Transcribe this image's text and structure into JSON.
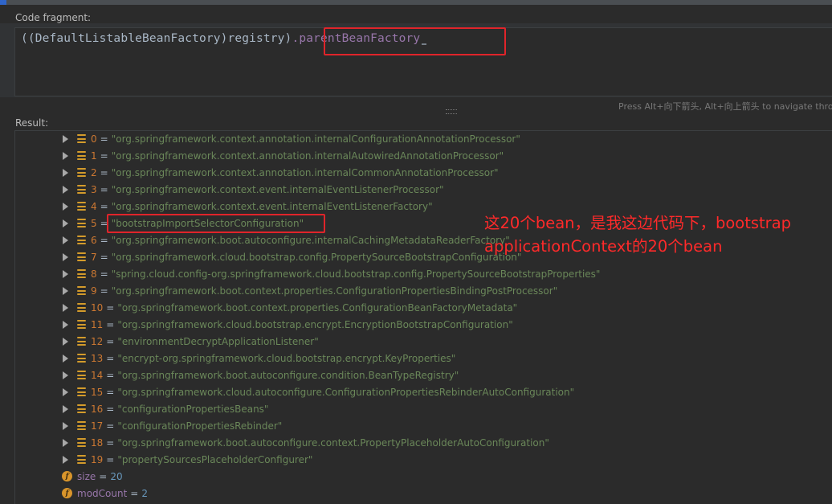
{
  "code_fragment_label": "Code fragment:",
  "code": {
    "prefix": "((DefaultListableBeanFactory)registry)",
    "field": ".parentBeanFactory"
  },
  "hint": "Press Alt+向下箭头, Alt+向上箭头 to navigate throu",
  "result_label": "Result:",
  "items": [
    {
      "index": "0",
      "value": "\"org.springframework.context.annotation.internalConfigurationAnnotationProcessor\""
    },
    {
      "index": "1",
      "value": "\"org.springframework.context.annotation.internalAutowiredAnnotationProcessor\""
    },
    {
      "index": "2",
      "value": "\"org.springframework.context.annotation.internalCommonAnnotationProcessor\""
    },
    {
      "index": "3",
      "value": "\"org.springframework.context.event.internalEventListenerProcessor\""
    },
    {
      "index": "4",
      "value": "\"org.springframework.context.event.internalEventListenerFactory\""
    },
    {
      "index": "5",
      "value": "\"bootstrapImportSelectorConfiguration\""
    },
    {
      "index": "6",
      "value": "\"org.springframework.boot.autoconfigure.internalCachingMetadataReaderFactory\""
    },
    {
      "index": "7",
      "value": "\"org.springframework.cloud.bootstrap.config.PropertySourceBootstrapConfiguration\""
    },
    {
      "index": "8",
      "value": "\"spring.cloud.config-org.springframework.cloud.bootstrap.config.PropertySourceBootstrapProperties\""
    },
    {
      "index": "9",
      "value": "\"org.springframework.boot.context.properties.ConfigurationPropertiesBindingPostProcessor\""
    },
    {
      "index": "10",
      "value": "\"org.springframework.boot.context.properties.ConfigurationBeanFactoryMetadata\""
    },
    {
      "index": "11",
      "value": "\"org.springframework.cloud.bootstrap.encrypt.EncryptionBootstrapConfiguration\""
    },
    {
      "index": "12",
      "value": "\"environmentDecryptApplicationListener\""
    },
    {
      "index": "13",
      "value": "\"encrypt-org.springframework.cloud.bootstrap.encrypt.KeyProperties\""
    },
    {
      "index": "14",
      "value": "\"org.springframework.boot.autoconfigure.condition.BeanTypeRegistry\""
    },
    {
      "index": "15",
      "value": "\"org.springframework.cloud.autoconfigure.ConfigurationPropertiesRebinderAutoConfiguration\""
    },
    {
      "index": "16",
      "value": "\"configurationPropertiesBeans\""
    },
    {
      "index": "17",
      "value": "\"configurationPropertiesRebinder\""
    },
    {
      "index": "18",
      "value": "\"org.springframework.boot.autoconfigure.context.PropertyPlaceholderAutoConfiguration\""
    },
    {
      "index": "19",
      "value": "\"propertySourcesPlaceholderConfigurer\""
    }
  ],
  "fields": [
    {
      "icon": "f",
      "name": "size",
      "value": "20"
    },
    {
      "icon": "f",
      "name": "modCount",
      "value": "2"
    }
  ],
  "annotation": "这20个bean，是我这边代码下，bootstrap applicationContext的20个bean",
  "colors": {
    "background": "#2b2b2b",
    "string": "#6a8759",
    "keyword_index": "#cc7832",
    "field": "#9876aa",
    "number": "#6897bb",
    "highlight_box": "#e0242a",
    "annotation_text": "#ff2a2a"
  }
}
